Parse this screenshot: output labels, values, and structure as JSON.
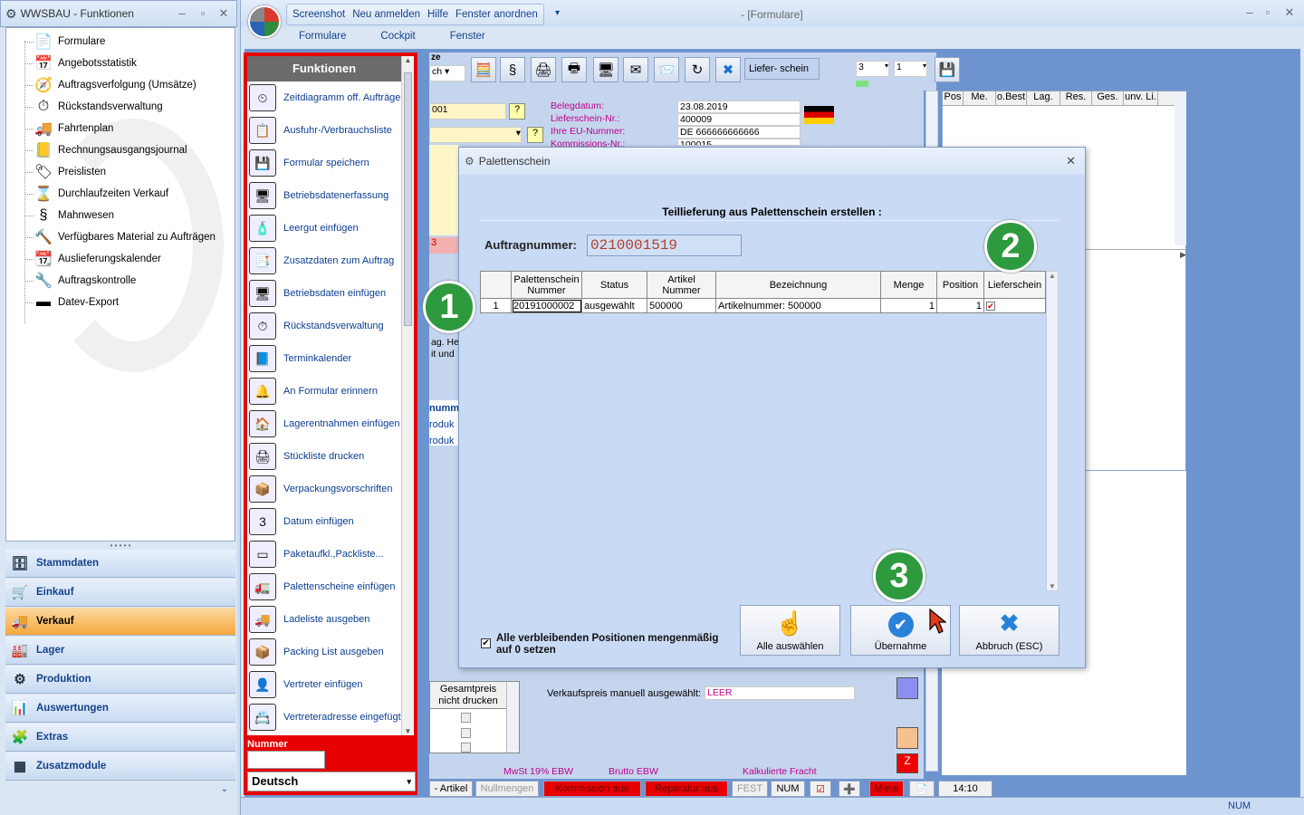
{
  "left_window": {
    "title": "WWSBAU - Funktionen",
    "tree_items": [
      {
        "label": "Formulare",
        "icon": "document-icon",
        "glyph": "📄"
      },
      {
        "label": "Angebotsstatistik",
        "icon": "statistics-icon",
        "glyph": "📅"
      },
      {
        "label": "Auftragsverfolgung (Umsätze)",
        "icon": "tracking-icon",
        "glyph": "🧭"
      },
      {
        "label": "Rückstandsverwaltung",
        "icon": "backlog-icon",
        "glyph": "⏱"
      },
      {
        "label": "Fahrtenplan",
        "icon": "truck-icon",
        "glyph": "🚚"
      },
      {
        "label": "Rechnungsausgangsjournal",
        "icon": "journal-icon",
        "glyph": "📒"
      },
      {
        "label": "Preislisten",
        "icon": "price-tag-icon",
        "glyph": "🏷"
      },
      {
        "label": "Durchlaufzeiten Verkauf",
        "icon": "hourglass-icon",
        "glyph": "⌛"
      },
      {
        "label": "Mahnwesen",
        "icon": "dunning-icon",
        "glyph": "§"
      },
      {
        "label": "Verfügbares Material zu Aufträgen",
        "icon": "hammer-icon",
        "glyph": "🔨"
      },
      {
        "label": "Auslieferungskalender",
        "icon": "calendar-icon",
        "glyph": "📆"
      },
      {
        "label": "Auftragskontrolle",
        "icon": "control-icon",
        "glyph": "🔧"
      },
      {
        "label": "Datev-Export",
        "icon": "datev-icon",
        "glyph": "▬"
      }
    ],
    "nav_buttons": [
      {
        "label": "Stammdaten",
        "glyph": "🗄"
      },
      {
        "label": "Einkauf",
        "glyph": "🛒"
      },
      {
        "label": "Verkauf",
        "glyph": "🚚",
        "active": true
      },
      {
        "label": "Lager",
        "glyph": "🏭"
      },
      {
        "label": "Produktion",
        "glyph": "⚙"
      },
      {
        "label": "Auswertungen",
        "glyph": "📊"
      },
      {
        "label": "Extras",
        "glyph": "🧩"
      },
      {
        "label": "Zusatzmodule",
        "glyph": "▦"
      }
    ]
  },
  "main_window": {
    "title": "- [Formulare]",
    "quick_menu": [
      "Screenshot",
      "Neu anmelden",
      "Hilfe",
      "Fenster anordnen"
    ],
    "menubar": [
      "Formulare",
      "Cockpit",
      "Fenster"
    ],
    "toolbar": {
      "lieferschein_label": "Liefer-    schein",
      "combo1": "3",
      "combo2": "1"
    }
  },
  "funktionen": {
    "header": "Funktionen",
    "items": [
      {
        "label": "Zeitdiagramm off. Aufträge",
        "glyph": "⏲"
      },
      {
        "label": "Ausfuhr-/Verbrauchsliste",
        "glyph": "📋"
      },
      {
        "label": "Formular speichern",
        "glyph": "💾"
      },
      {
        "label": "Betriebsdatenerfassung",
        "glyph": "🖥"
      },
      {
        "label": "Leergut einfügen",
        "glyph": "🧴"
      },
      {
        "label": "Zusatzdaten zum Auftrag",
        "glyph": "📑"
      },
      {
        "label": "Betriebsdaten einfügen",
        "glyph": "🖥"
      },
      {
        "label": "Rückstandsverwaltung",
        "glyph": "⏱"
      },
      {
        "label": "Terminkalender",
        "glyph": "📘"
      },
      {
        "label": "An Formular erinnern",
        "glyph": "🔔"
      },
      {
        "label": "Lagerentnahmen einfügen",
        "glyph": "🏠"
      },
      {
        "label": "Stückliste drucken",
        "glyph": "🖨"
      },
      {
        "label": "Verpackungsvorschriften",
        "glyph": "📦"
      },
      {
        "label": "Datum einfügen",
        "glyph": "3"
      },
      {
        "label": "Paketaufkl.,Packliste...",
        "glyph": "▭"
      },
      {
        "label": "Palettenscheine einfügen",
        "glyph": "🚛"
      },
      {
        "label": "Ladeliste ausgeben",
        "glyph": "🚚"
      },
      {
        "label": "Packing List ausgeben",
        "glyph": "📦"
      },
      {
        "label": "Vertreter einfügen",
        "glyph": "👤"
      },
      {
        "label": "Vertreteradresse eingefügt",
        "glyph": "📇"
      }
    ],
    "nummer_label": "Nummer",
    "language": "Deutsch"
  },
  "form": {
    "fields": [
      {
        "label": "Belegdatum:",
        "value": "23.08.2019"
      },
      {
        "label": "Lieferschein-Nr.:",
        "value": "400009"
      },
      {
        "label": "Ihre EU-Nummer:",
        "value": "DE 666666666666"
      },
      {
        "label": "Kommissions-Nr.:",
        "value": "100015"
      }
    ],
    "partial_001": "001",
    "partial_ze": "ze",
    "partial_ch": "ch",
    "partial_3": "3",
    "partial_text": [
      "ag. He",
      "it und"
    ],
    "partial_numm": "numm",
    "partial_produk": [
      "roduk",
      "roduk"
    ],
    "gesamtpreis_header": "Gesamtpreis nicht drucken",
    "vk_manual_label": "Verkaufspreis manuell ausgewählt:",
    "vk_manual_value": "LEER",
    "bottom_cut_labels": [
      "MwSt 19% EBW",
      "Brutto EBW",
      "Kalkulierte Fracht"
    ]
  },
  "right_grid": {
    "columns": [
      "Pos",
      "Me.",
      "o.Best",
      "Lag.",
      "Res.",
      "Ges.",
      "unv. Li."
    ]
  },
  "statusbar": {
    "items": [
      "- Artikel",
      "Nullmengen",
      "Kommission aus",
      "Reparatur aus",
      "FEST",
      "NUM",
      "☑",
      "➕",
      "Miete",
      "📄",
      "14:10"
    ],
    "os_num": "NUM"
  },
  "dialog": {
    "title": "Palettenschein",
    "subtitle": "Teillieferung aus Palettenschein erstellen :",
    "auftrag_label": "Auftragnummer:",
    "auftrag_value": "0210001519",
    "columns": [
      "",
      "Palettenschein Nummer",
      "Status",
      "Artikel Nummer",
      "Bezeichnung",
      "Menge",
      "Position",
      "Lieferschein"
    ],
    "rows": [
      {
        "idx": "1",
        "palettenschein": "20191000002",
        "status": "ausgewählt",
        "artikel": "500000",
        "bezeichnung": "Artikelnummer: 500000",
        "menge": "1",
        "position": "1",
        "lieferschein_checked": true
      }
    ],
    "checkbox_label": "Alle verbleibenden Positionen mengenmäßig auf 0 setzen",
    "checkbox_checked": true,
    "buttons": {
      "select_all": "Alle auswählen",
      "accept": "Übernahme",
      "cancel": "Abbruch (ESC)"
    }
  },
  "callouts": [
    "1",
    "2",
    "3"
  ],
  "colors": {
    "accent_red": "#e60000",
    "callout_green": "#2e9a3e",
    "active_nav": "#f7a83c",
    "workspace_blue": "#6e94cf"
  }
}
